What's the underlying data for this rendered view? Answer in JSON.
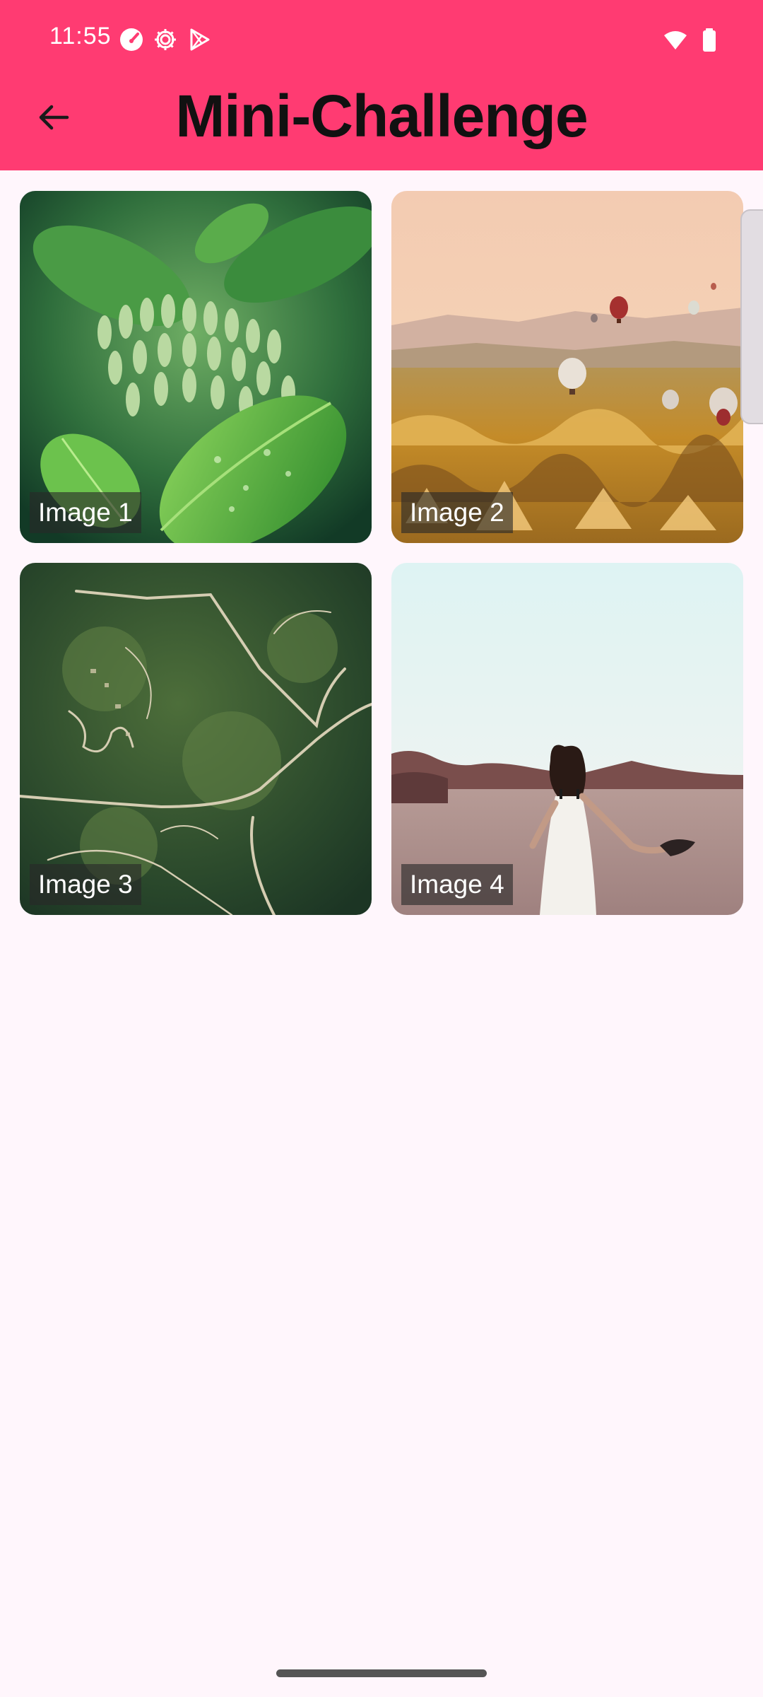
{
  "status_bar": {
    "time": "11:55",
    "icons": [
      "speedometer-icon",
      "gear-icon",
      "play-store-icon",
      "wifi-icon",
      "battery-icon"
    ]
  },
  "app_bar": {
    "title": "Mini-Challenge",
    "back_icon": "arrow-back-icon",
    "background": "#ff3b72"
  },
  "grid": {
    "items": [
      {
        "label": "Image 1"
      },
      {
        "label": "Image 2"
      },
      {
        "label": "Image 3"
      },
      {
        "label": "Image 4"
      }
    ]
  }
}
